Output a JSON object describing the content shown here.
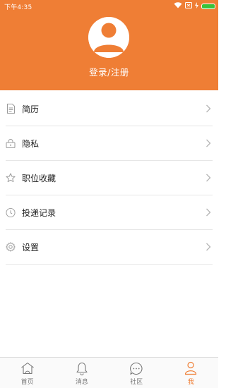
{
  "status_bar": {
    "time": "下午4:35",
    "icons": [
      "wifi-icon",
      "sim-icon",
      "charging-icon",
      "battery-icon"
    ],
    "battery_color": "#39c23a"
  },
  "header": {
    "background_color": "#ef7e35",
    "login_label": "登录/注册",
    "avatar_icon": "default-user-avatar"
  },
  "menu": {
    "items": [
      {
        "label": "简历",
        "icon": "resume-document-icon"
      },
      {
        "label": "隐私",
        "icon": "privacy-lock-icon"
      },
      {
        "label": "职位收藏",
        "icon": "star-icon"
      },
      {
        "label": "投递记录",
        "icon": "clock-icon"
      },
      {
        "label": "设置",
        "icon": "gear-icon"
      }
    ]
  },
  "tabbar": {
    "tabs": [
      {
        "label": "首页",
        "icon": "home-icon",
        "active": false
      },
      {
        "label": "消息",
        "icon": "bell-icon",
        "active": false
      },
      {
        "label": "社区",
        "icon": "chat-bubble-icon",
        "active": false
      },
      {
        "label": "我",
        "icon": "user-icon",
        "active": true
      }
    ],
    "active_color": "#ef7e35"
  }
}
